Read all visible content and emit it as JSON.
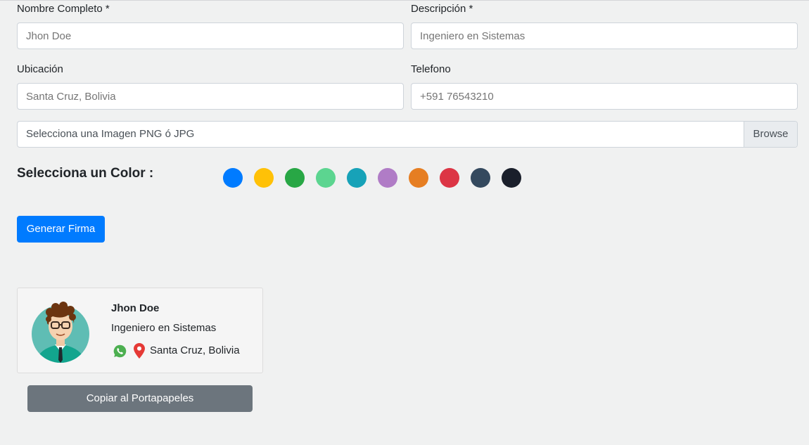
{
  "form": {
    "name_label": "Nombre Completo *",
    "name_placeholder": "Jhon Doe",
    "desc_label": "Descripción *",
    "desc_placeholder": "Ingeniero en Sistemas",
    "location_label": "Ubicación",
    "location_placeholder": "Santa Cruz, Bolivia",
    "phone_label": "Telefono",
    "phone_placeholder": "+591 76543210",
    "file_label": "Selecciona una Imagen PNG ó JPG",
    "browse_label": "Browse"
  },
  "colors": {
    "title": "Selecciona un Color :",
    "swatches": [
      "#007bff",
      "#ffc107",
      "#28a745",
      "#5cd590",
      "#17a2b8",
      "#b07cc6",
      "#e67e22",
      "#dc3545",
      "#34495e",
      "#1a1f2b"
    ]
  },
  "generate_button": "Generar Firma",
  "signature": {
    "name": "Jhon Doe",
    "description": "Ingeniero en Sistemas",
    "location": "Santa Cruz, Bolivia",
    "icons": [
      "avatar-image",
      "whatsapp-icon",
      "location-pin-icon"
    ]
  },
  "copy_button": "Copiar al Portapapeles"
}
